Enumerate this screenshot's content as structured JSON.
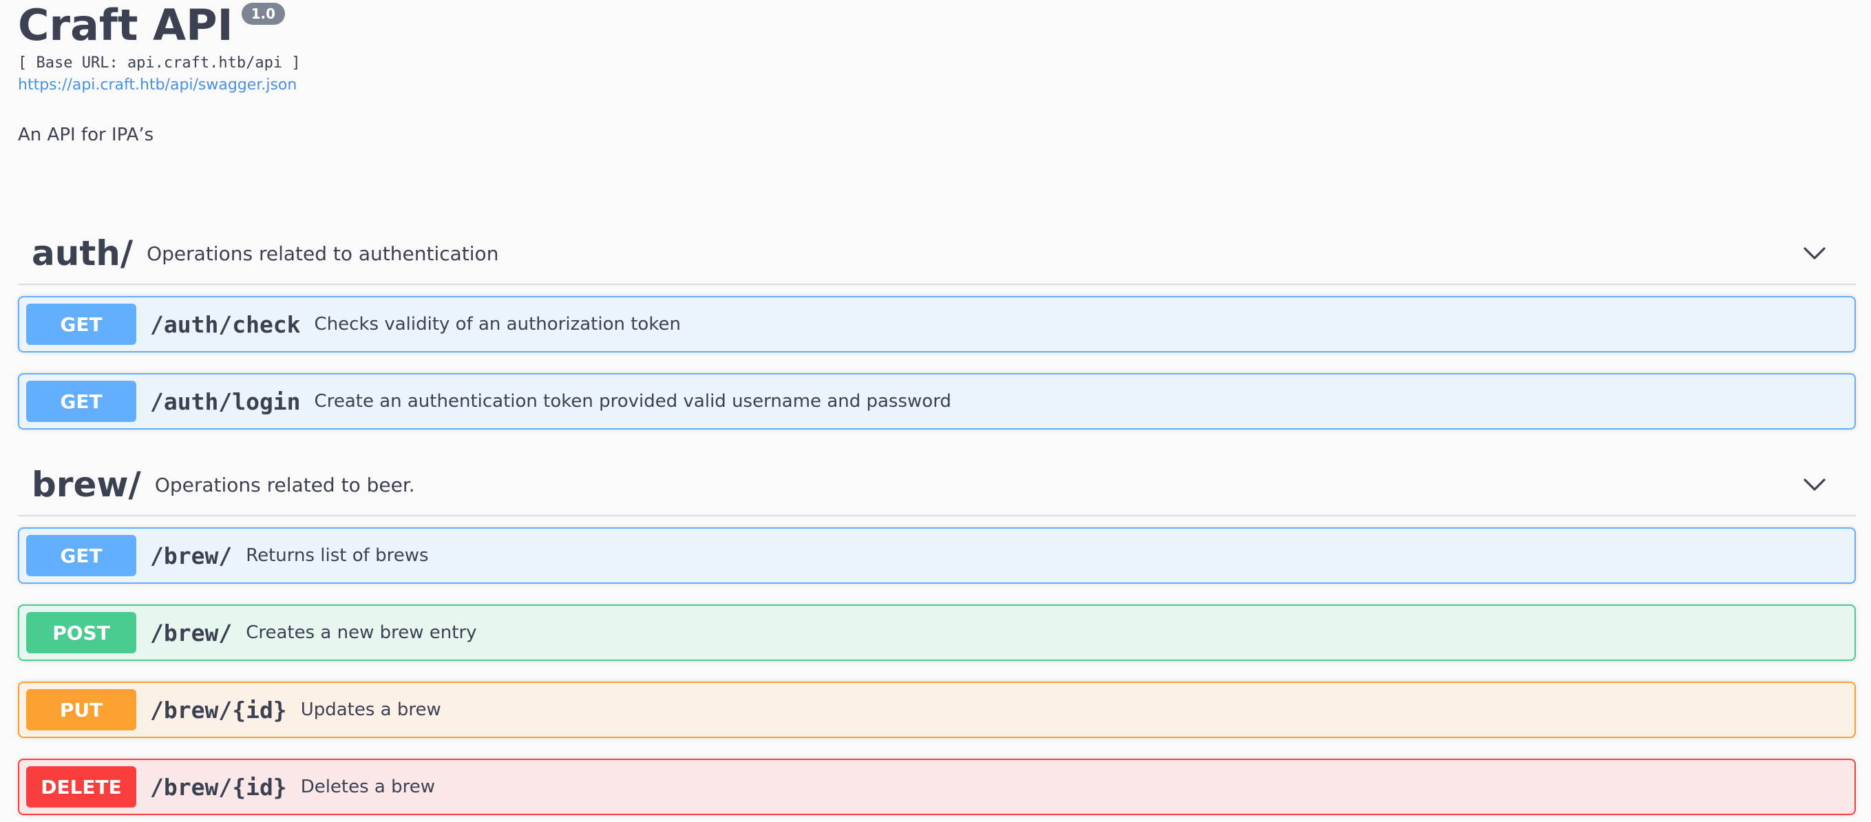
{
  "info": {
    "title": "Craft API",
    "version": "1.0",
    "base_url": "[ Base URL: api.craft.htb/api ]",
    "spec_link": "https://api.craft.htb/api/swagger.json",
    "description": "An API for IPA’s"
  },
  "tags": [
    {
      "name": "auth/",
      "description": "Operations related to authentication",
      "expanded": true,
      "operations": [
        {
          "method": "GET",
          "path": "/auth/check",
          "summary": "Checks validity of an authorization token"
        },
        {
          "method": "GET",
          "path": "/auth/login",
          "summary": "Create an authentication token provided valid username and password"
        }
      ]
    },
    {
      "name": "brew/",
      "description": "Operations related to beer.",
      "expanded": true,
      "operations": [
        {
          "method": "GET",
          "path": "/brew/",
          "summary": "Returns list of brews"
        },
        {
          "method": "POST",
          "path": "/brew/",
          "summary": "Creates a new brew entry"
        },
        {
          "method": "PUT",
          "path": "/brew/{id}",
          "summary": "Updates a brew"
        },
        {
          "method": "DELETE",
          "path": "/brew/{id}",
          "summary": "Deletes a brew"
        }
      ]
    }
  ],
  "colors": {
    "get": "#61affe",
    "post": "#49cc90",
    "put": "#fca130",
    "delete": "#f93e3e",
    "link": "#4990e2",
    "text": "#3b4151",
    "version_badge": "#7d8492"
  },
  "icons": {
    "tag_toggle": "chevron-down-icon"
  }
}
